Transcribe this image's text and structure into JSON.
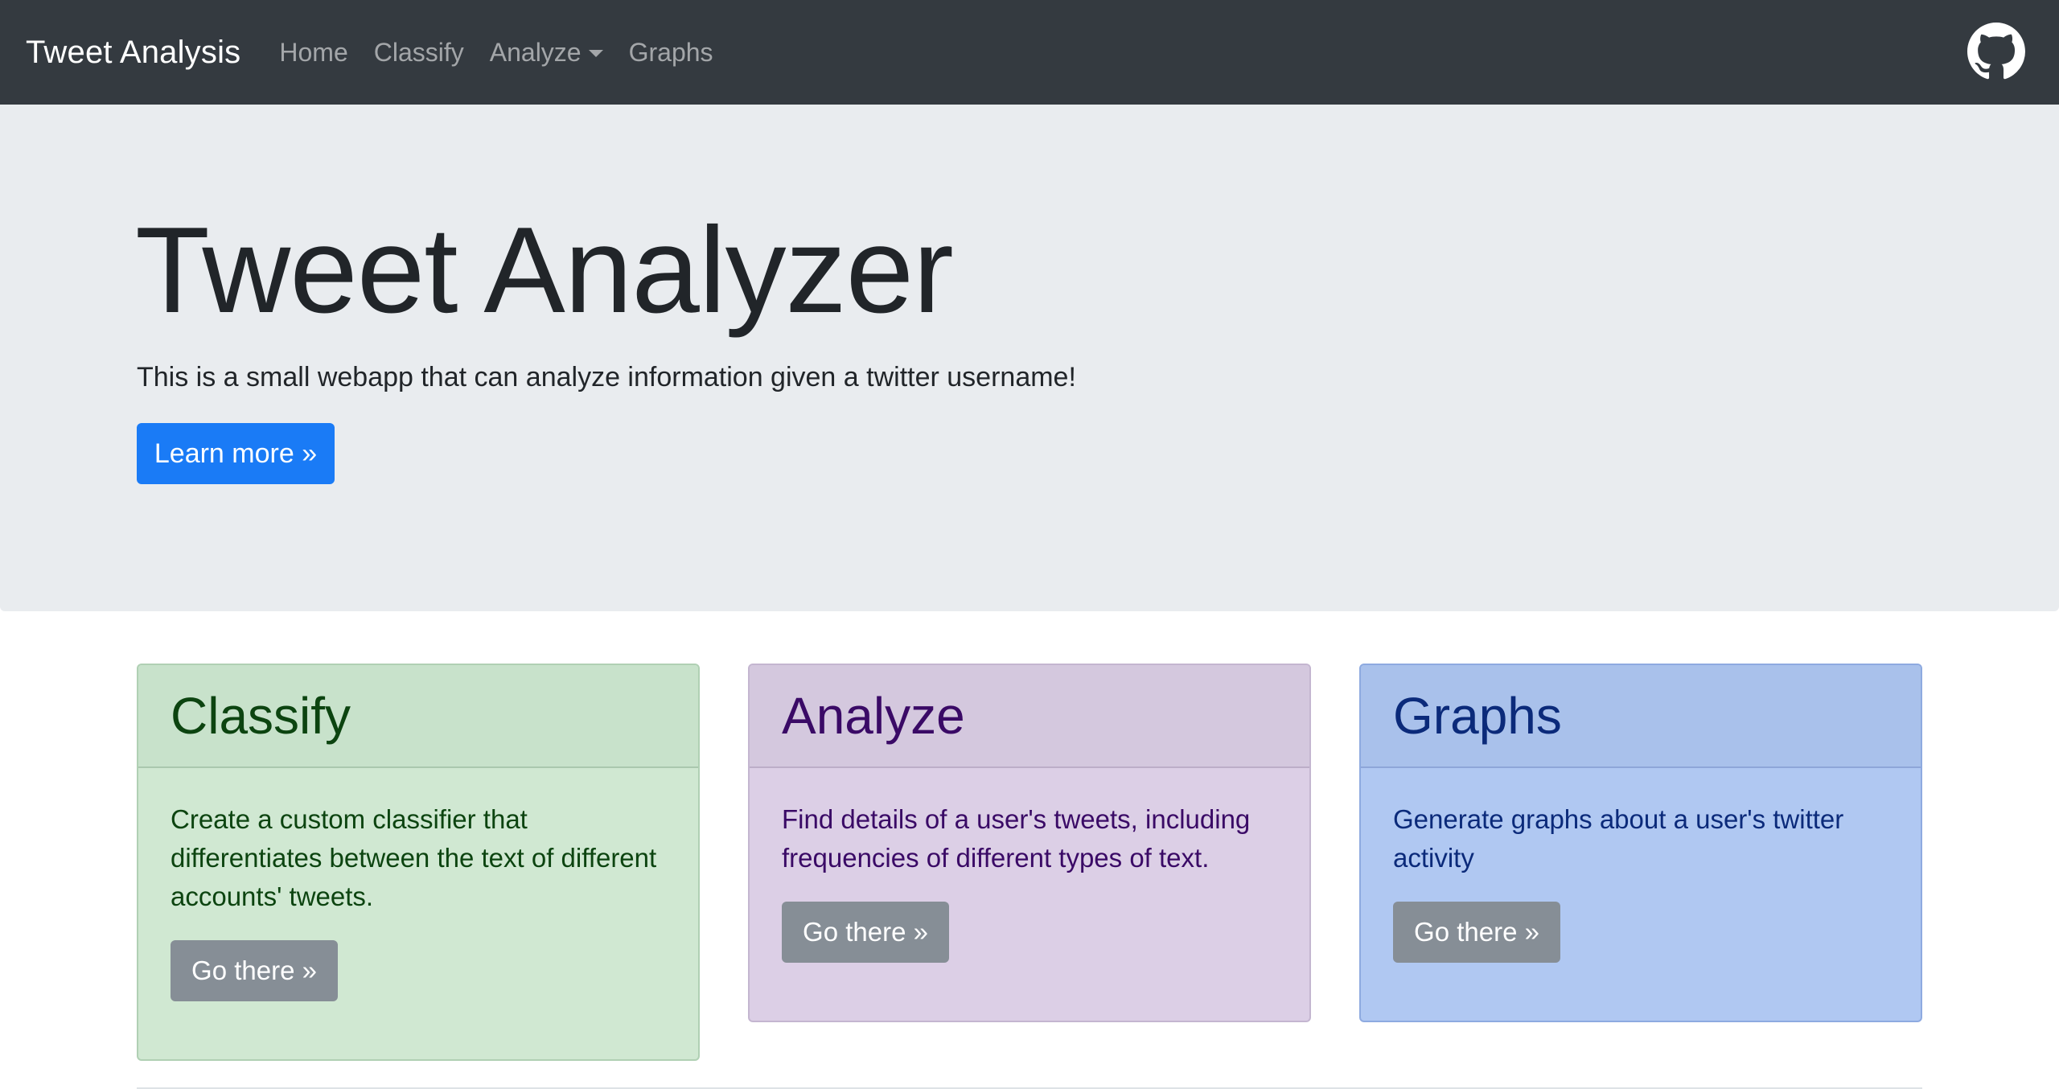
{
  "navbar": {
    "brand": "Tweet Analysis",
    "links": [
      {
        "label": "Home"
      },
      {
        "label": "Classify"
      },
      {
        "label": "Analyze",
        "dropdown": true
      },
      {
        "label": "Graphs"
      }
    ],
    "github_icon": "github-icon"
  },
  "jumbotron": {
    "title": "Tweet Analyzer",
    "lead": "This is a small webapp that can analyze information given a twitter username!",
    "button_label": "Learn more »"
  },
  "cards": [
    {
      "title": "Classify",
      "text": "Create a custom classifier that differentiates between the text of different accounts' tweets.",
      "button_label": "Go there »"
    },
    {
      "title": "Analyze",
      "text": "Find details of a user's tweets, including frequencies of different types of text.",
      "button_label": "Go there »"
    },
    {
      "title": "Graphs",
      "text": "Generate graphs about a user's twitter activity",
      "button_label": "Go there »"
    }
  ],
  "colors": {
    "navbar": "#343a40",
    "jumbotron": "#e9ecef",
    "primary_button": "#1a7bf6",
    "secondary_button": "#868e96",
    "classify_card": "#d0e8d2",
    "analyze_card": "#dccfe6",
    "graphs_card": "#b0c8f2"
  }
}
